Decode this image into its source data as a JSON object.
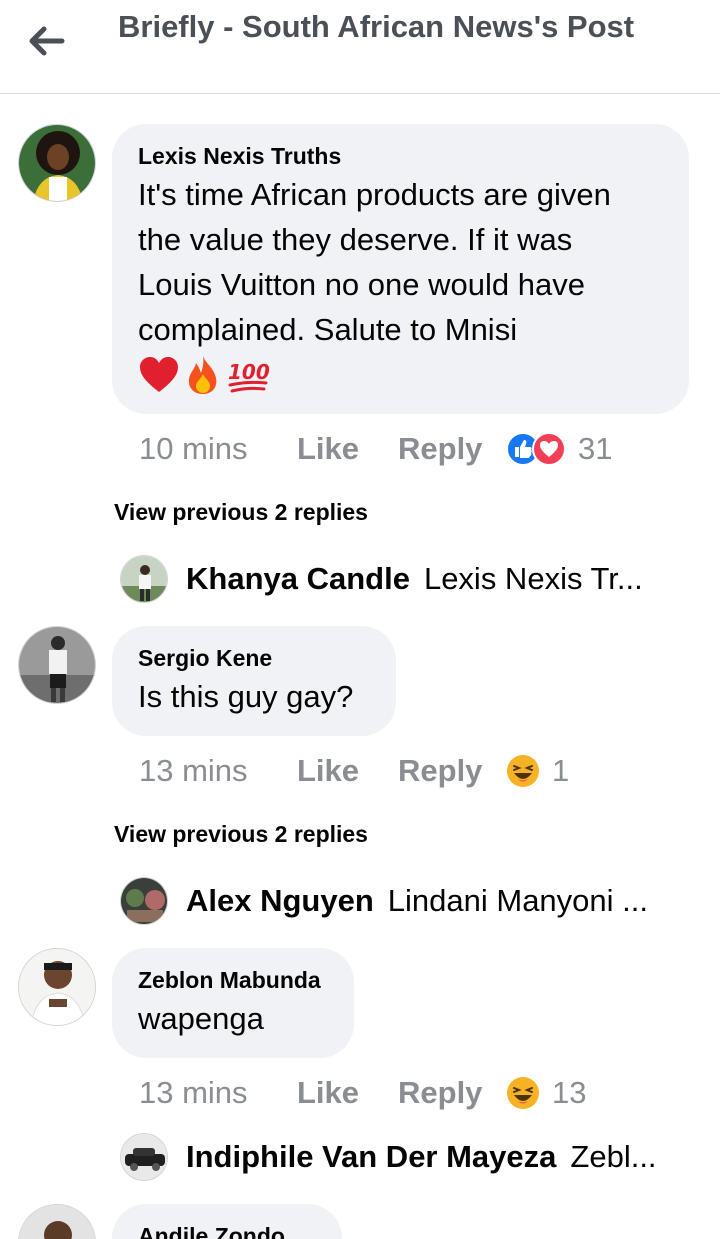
{
  "header": {
    "title": "Briefly - South African News's Post"
  },
  "comments": [
    {
      "author": "Lexis Nexis Truths",
      "text_lines": [
        "It's time African products are given",
        "the value they deserve. If it was",
        "Louis Vuitton no one would have",
        "complained. Salute to Mnisi"
      ],
      "emojis": [
        "❤️",
        "🔥",
        "💯"
      ],
      "time": "10 mins",
      "like_label": "Like",
      "reply_label": "Reply",
      "reaction_count": "31",
      "view_previous": "View previous 2 replies",
      "reply_preview": {
        "name": "Khanya Candle",
        "text": "Lexis Nexis Tr..."
      }
    },
    {
      "author": "Sergio Kene",
      "text_lines": [
        "Is this guy gay?"
      ],
      "time": "13 mins",
      "like_label": "Like",
      "reply_label": "Reply",
      "reaction_count": "1",
      "view_previous": "View previous 2 replies",
      "reply_preview": {
        "name": "Alex Nguyen",
        "text": "Lindani Manyoni ..."
      }
    },
    {
      "author": "Zeblon Mabunda",
      "text_lines": [
        "wapenga"
      ],
      "time": "13 mins",
      "like_label": "Like",
      "reply_label": "Reply",
      "reaction_count": "13",
      "reply_preview": {
        "name": "Indiphile Van Der Mayeza",
        "text": "Zebl..."
      }
    },
    {
      "author": "Andile Zondo"
    }
  ],
  "icons": {
    "back": "arrow-left-icon",
    "like_reaction": "thumbs-up-icon",
    "love_reaction": "heart-icon",
    "haha_reaction": "laughing-face-icon"
  },
  "colors": {
    "like_blue": "#1877f2",
    "love_red": "#f33e58",
    "haha_yellow": "#f7b125",
    "muted_text": "#8a8d91",
    "bubble_bg": "#f0f2f5"
  }
}
